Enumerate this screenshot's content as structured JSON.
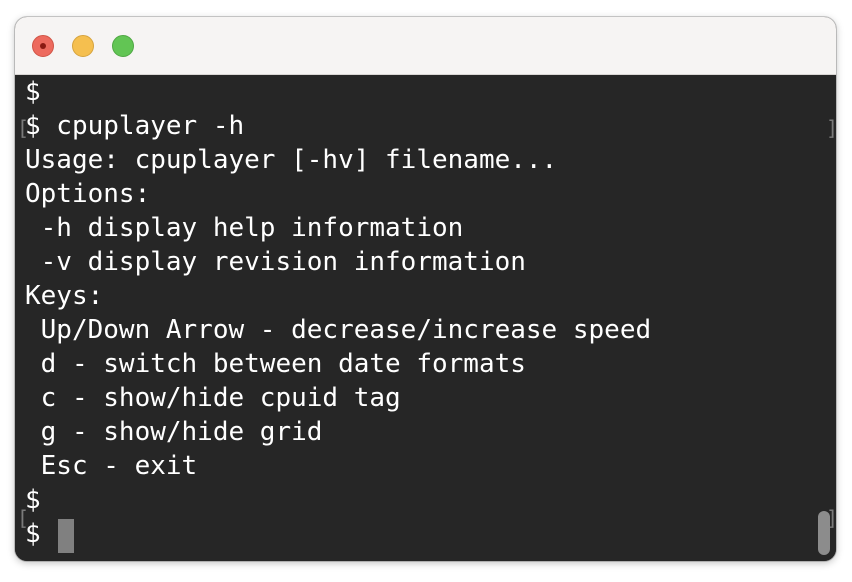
{
  "terminal": {
    "lines": [
      "$",
      "$ cpuplayer -h",
      "Usage: cpuplayer [-hv] filename...",
      "Options:",
      " -h display help information",
      " -v display revision information",
      "Keys:",
      " Up/Down Arrow - decrease/increase speed",
      " d - switch between date formats",
      " c - show/hide cpuid tag",
      " g - show/hide grid",
      " Esc - exit",
      "$",
      "$ "
    ],
    "mark_left": "[",
    "mark_right": "]"
  },
  "window": {
    "buttons": [
      "close",
      "minimize",
      "zoom"
    ]
  },
  "colors": {
    "terminal_bg": "#262626",
    "text": "#ffffff",
    "titlebar": "#f6f4f3",
    "close": "#ed6a5e",
    "minimize": "#f5bf4f",
    "zoom": "#62c554",
    "cursor": "#808080"
  }
}
